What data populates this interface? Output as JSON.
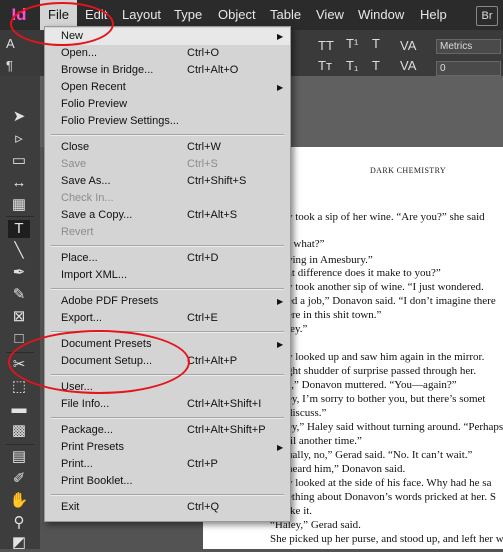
{
  "menubar": {
    "logo": "Id",
    "items": [
      "File",
      "Edit",
      "Layout",
      "Type",
      "Object",
      "Table",
      "View",
      "Window",
      "Help"
    ],
    "bridge": "Br"
  },
  "control": {
    "kerning": "Metrics",
    "tracking": "0"
  },
  "file_menu": {
    "new": {
      "label": "New"
    },
    "open": {
      "label": "Open...",
      "shortcut": "Ctrl+O"
    },
    "browse": {
      "label": "Browse in Bridge...",
      "shortcut": "Ctrl+Alt+O"
    },
    "open_recent": {
      "label": "Open Recent"
    },
    "folio_preview": {
      "label": "Folio Preview"
    },
    "folio_settings": {
      "label": "Folio Preview Settings..."
    },
    "close": {
      "label": "Close",
      "shortcut": "Ctrl+W"
    },
    "save": {
      "label": "Save",
      "shortcut": "Ctrl+S"
    },
    "save_as": {
      "label": "Save As...",
      "shortcut": "Ctrl+Shift+S"
    },
    "check_in": {
      "label": "Check In..."
    },
    "save_copy": {
      "label": "Save a Copy...",
      "shortcut": "Ctrl+Alt+S"
    },
    "revert": {
      "label": "Revert"
    },
    "place": {
      "label": "Place...",
      "shortcut": "Ctrl+D"
    },
    "import_xml": {
      "label": "Import XML..."
    },
    "pdf_presets": {
      "label": "Adobe PDF Presets"
    },
    "export": {
      "label": "Export...",
      "shortcut": "Ctrl+E"
    },
    "doc_presets": {
      "label": "Document Presets"
    },
    "doc_setup": {
      "label": "Document Setup...",
      "shortcut": "Ctrl+Alt+P"
    },
    "user": {
      "label": "User..."
    },
    "file_info": {
      "label": "File Info...",
      "shortcut": "Ctrl+Alt+Shift+I"
    },
    "package": {
      "label": "Package...",
      "shortcut": "Ctrl+Alt+Shift+P"
    },
    "print_presets": {
      "label": "Print Presets"
    },
    "print": {
      "label": "Print...",
      "shortcut": "Ctrl+P"
    },
    "print_booklet": {
      "label": "Print Booklet..."
    },
    "exit": {
      "label": "Exit",
      "shortcut": "Ctrl+Q"
    }
  },
  "document": {
    "title": "DARK CHEMISTRY",
    "lines": [
      "y took a sip of her wine. “Are you?” she said",
      "I what?”",
      "ving in Amesbury.”",
      "at difference does it make to you?”",
      "y took another sip of wine. “I just wondered.",
      "ed a job,” Donavon said. “I don’t imagine there",
      "ere in this shit town.”",
      "ley.”",
      "y looked up and saw him again in the mirror.",
      "ght shudder of surprise passed through her.",
      "s,” Donavon muttered. “You—again?”",
      "ey, I’m sorry to bother you, but there’s somet",
      " discuss.”",
      "ey,” Haley said without turning around. “Perhaps i",
      "til another time.”",
      "ually, no,” Gerad said. “No. It can’t wait.”",
      " heard him,” Donavon said.",
      "y looked at the side of his face. Why had he sa",
      "ething about Donavon’s words pricked at her. S",
      "ike it.",
      "“Haley,” Gerad said.",
      "She picked up her purse, and stood up, and left her wine"
    ]
  }
}
